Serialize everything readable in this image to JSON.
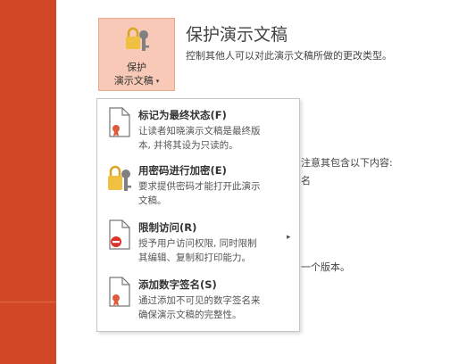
{
  "protect_button": {
    "label_line1": "保护",
    "label_line2": "演示文稿",
    "caret": "▾"
  },
  "header": {
    "title": "保护演示文稿",
    "description": "控制其他人可以对此演示文稿所做的更改类型。"
  },
  "background_text": {
    "line1": "注意其包含以下内容:",
    "line2": "名",
    "line3": "一个版本。"
  },
  "menu": {
    "items": [
      {
        "title": "标记为最终状态(F)",
        "desc1": "让读者知晓演示文稿是最终版",
        "desc2": "本, 并将其设为只读的。",
        "icon": "final-document-icon"
      },
      {
        "title": "用密码进行加密(E)",
        "desc1": "要求提供密码才能打开此演示",
        "desc2": "文稿。",
        "icon": "lock-key-icon"
      },
      {
        "title": "限制访问(R)",
        "desc1": "授予用户访问权限, 同时限制",
        "desc2": "其编辑、复制和打印能力。",
        "icon": "restrict-access-icon",
        "submenu_arrow": "▸"
      },
      {
        "title": "添加数字签名(S)",
        "desc1": "通过添加不可见的数字签名来",
        "desc2": "确保演示文稿的完整性。",
        "icon": "digital-signature-icon"
      }
    ]
  },
  "colors": {
    "sidebar": "#d24726",
    "button_highlight": "#f7c9b6"
  }
}
